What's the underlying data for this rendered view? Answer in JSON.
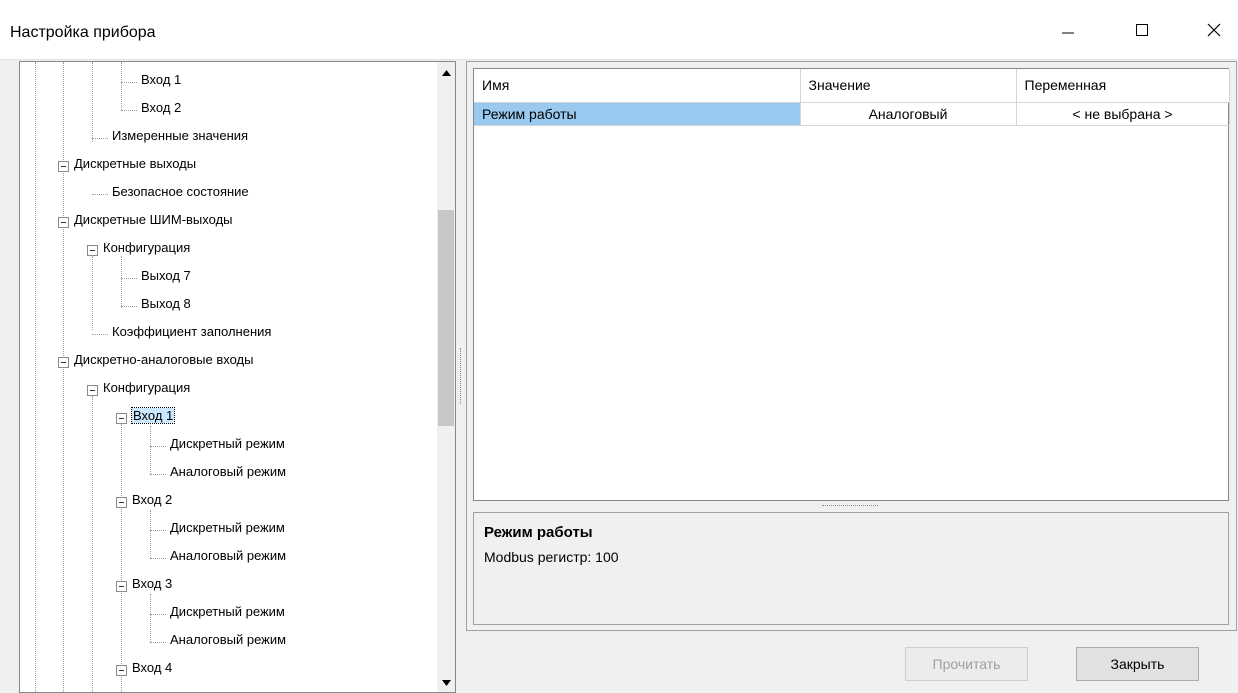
{
  "window": {
    "title": "Настройка прибора",
    "controls": {
      "minimize_icon": "minimize-icon",
      "maximize_icon": "maximize-icon",
      "close_icon": "close-icon"
    }
  },
  "tree": {
    "nodes": [
      {
        "label": "Вход 1"
      },
      {
        "label": "Вход 2"
      },
      {
        "label": "Измеренные значения"
      },
      {
        "label": "Дискретные выходы"
      },
      {
        "label": "Безопасное состояние"
      },
      {
        "label": "Дискретные ШИМ-выходы"
      },
      {
        "label": "Конфигурация"
      },
      {
        "label": "Выход 7"
      },
      {
        "label": "Выход 8"
      },
      {
        "label": "Коэффициент заполнения"
      },
      {
        "label": "Дискретно-аналоговые входы"
      },
      {
        "label": "Конфигурация"
      },
      {
        "label": "Вход 1"
      },
      {
        "label": "Дискретный режим"
      },
      {
        "label": "Аналоговый режим"
      },
      {
        "label": "Вход 2"
      },
      {
        "label": "Дискретный режим"
      },
      {
        "label": "Аналоговый режим"
      },
      {
        "label": "Вход 3"
      },
      {
        "label": "Дискретный режим"
      },
      {
        "label": "Аналоговый режим"
      },
      {
        "label": "Вход 4"
      }
    ]
  },
  "grid": {
    "headers": [
      "Имя",
      "Значение",
      "Переменная"
    ],
    "rows": [
      {
        "name": "Режим работы",
        "value": "Аналоговый",
        "variable": "< не выбрана >"
      }
    ]
  },
  "description": {
    "title": "Режим работы",
    "text": "Modbus регистр: 100"
  },
  "buttons": {
    "read": "Прочитать",
    "close": "Закрыть"
  },
  "colors": {
    "selection": "#99c9ef",
    "background": "#f0f0f0"
  }
}
